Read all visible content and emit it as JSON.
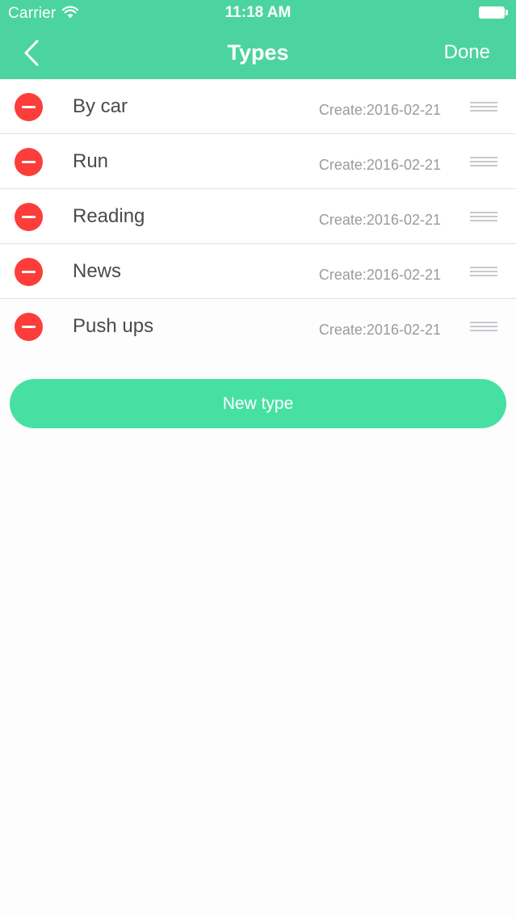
{
  "status_bar": {
    "carrier": "Carrier",
    "time": "11:18 AM",
    "wifi_icon": "wifi-icon",
    "battery_icon": "battery-icon"
  },
  "nav": {
    "back_icon": "chevron-left-icon",
    "title": "Types",
    "done_label": "Done"
  },
  "types": [
    {
      "name": "By car",
      "created": "Create:2016-02-21"
    },
    {
      "name": "Run",
      "created": "Create:2016-02-21"
    },
    {
      "name": "Reading",
      "created": "Create:2016-02-21"
    },
    {
      "name": "News",
      "created": "Create:2016-02-21"
    },
    {
      "name": "Push ups",
      "created": "Create:2016-02-21"
    }
  ],
  "row_icons": {
    "delete_icon": "minus-circle-icon",
    "reorder_icon": "reorder-handle-icon"
  },
  "new_type_label": "New type",
  "colors": {
    "accent": "#4cd4a0",
    "button": "#47e0a3",
    "delete": "#fc3d39",
    "text_primary": "#4a4a4f",
    "text_secondary": "#9a9aa0"
  }
}
